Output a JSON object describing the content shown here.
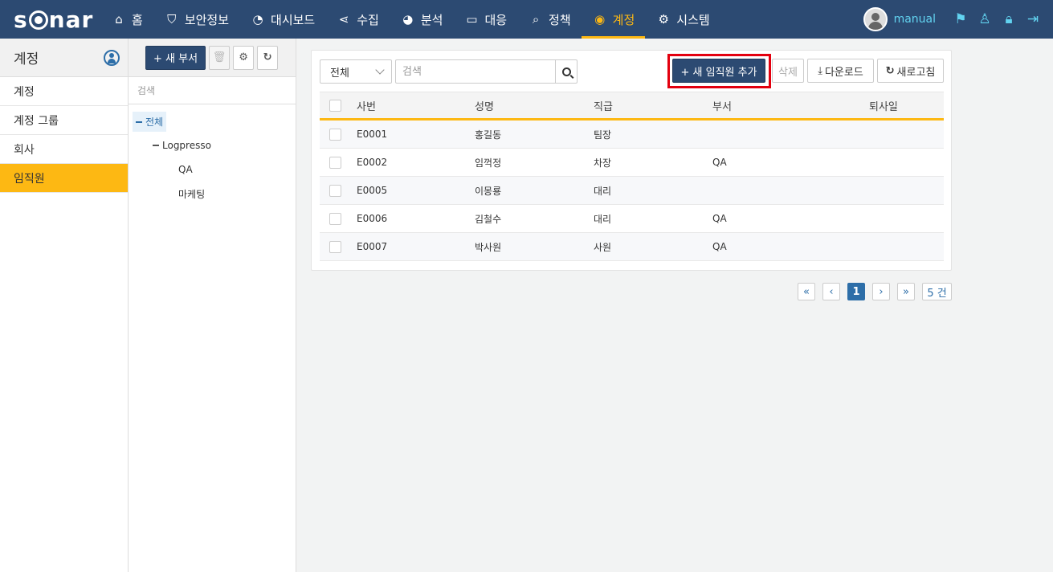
{
  "app": {
    "logo_text": "sonar"
  },
  "nav": {
    "items": [
      {
        "label": "홈",
        "icon": "home-icon"
      },
      {
        "label": "보안정보",
        "icon": "shield-icon"
      },
      {
        "label": "대시보드",
        "icon": "dashboard-icon"
      },
      {
        "label": "수집",
        "icon": "share-icon"
      },
      {
        "label": "분석",
        "icon": "pie-chart-icon"
      },
      {
        "label": "대응",
        "icon": "laptop-icon"
      },
      {
        "label": "정책",
        "icon": "search-icon"
      },
      {
        "label": "계정",
        "icon": "user-circle-icon",
        "active": true
      },
      {
        "label": "시스템",
        "icon": "gear-icon"
      }
    ],
    "username": "manual",
    "active_color": "#fdb813"
  },
  "sidebar": {
    "title": "계정",
    "items": [
      {
        "label": "계정"
      },
      {
        "label": "계정 그룹"
      },
      {
        "label": "회사"
      },
      {
        "label": "임직원",
        "active": true
      }
    ]
  },
  "tree": {
    "new_dept_label": "+ 새 부서",
    "search_placeholder": "검색",
    "nodes": [
      {
        "label": "전체",
        "level": 0,
        "selected": true
      },
      {
        "label": "Logpresso",
        "level": 1
      },
      {
        "label": "QA",
        "level": 2
      },
      {
        "label": "마케팅",
        "level": 2
      }
    ]
  },
  "toolbar": {
    "filter_value": "전체",
    "search_placeholder": "검색",
    "add_label": "+ 새 임직원 추가",
    "delete_label": "삭제",
    "download_label": "다운로드",
    "refresh_label": "새로고침"
  },
  "table": {
    "columns": [
      "사번",
      "성명",
      "직급",
      "부서",
      "퇴사일"
    ],
    "rows": [
      [
        "E0001",
        "홍길동",
        "팀장",
        "",
        ""
      ],
      [
        "E0002",
        "임꺽정",
        "차장",
        "QA",
        ""
      ],
      [
        "E0005",
        "이몽룡",
        "대리",
        "",
        ""
      ],
      [
        "E0006",
        "김철수",
        "대리",
        "QA",
        ""
      ],
      [
        "E0007",
        "박사원",
        "사원",
        "QA",
        ""
      ]
    ]
  },
  "pagination": {
    "first": "«",
    "prev": "‹",
    "current": "1",
    "next": "›",
    "last": "»",
    "total": "5 건"
  }
}
